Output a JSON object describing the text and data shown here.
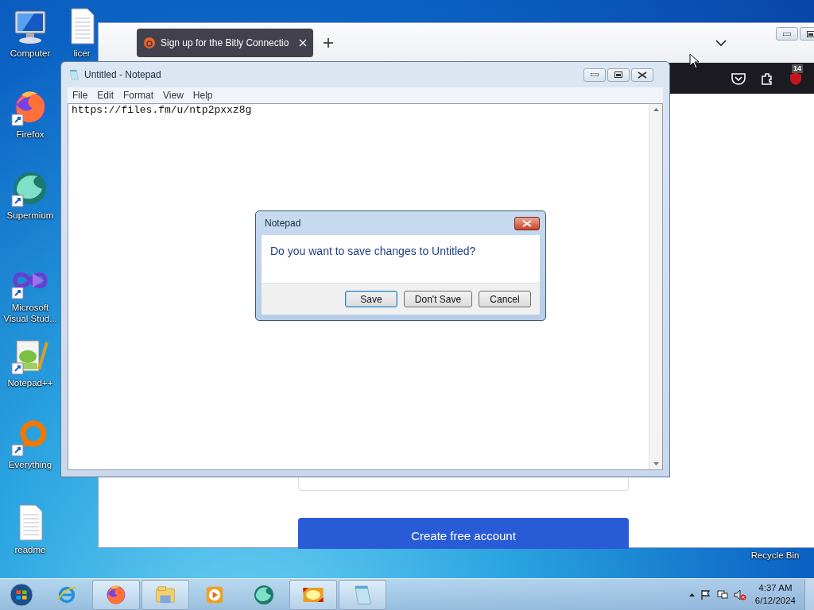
{
  "desktop_icons": [
    {
      "kind": "computer",
      "label": "Computer",
      "shortcut": false
    },
    {
      "kind": "document",
      "label": "licer",
      "shortcut": false
    },
    {
      "kind": "firefox",
      "label": "Firefox",
      "shortcut": true
    },
    {
      "kind": "supermium",
      "label": "Supermium",
      "shortcut": true
    },
    {
      "kind": "visualstudio",
      "label": "Microsoft Visual Stud...",
      "shortcut": true
    },
    {
      "kind": "notepadpp",
      "label": "Notepad++",
      "shortcut": true
    },
    {
      "kind": "everything",
      "label": "Everything",
      "shortcut": true
    },
    {
      "kind": "document",
      "label": "readme",
      "shortcut": false
    },
    {
      "label": "Recycle Bin"
    }
  ],
  "browser": {
    "tab": {
      "title": "Sign up for the Bitly Connectio"
    },
    "extension_badge": "14",
    "page": {
      "button": "Create free account"
    }
  },
  "notepad": {
    "title": "Untitled - Notepad",
    "menu": [
      "File",
      "Edit",
      "Format",
      "View",
      "Help"
    ],
    "content": "https://files.fm/u/ntp2pxxz8g"
  },
  "dialog": {
    "title": "Notepad",
    "message": "Do you want to save changes to Untitled?",
    "buttons": [
      {
        "label": "Save",
        "selected": true
      },
      {
        "label": "Don't Save",
        "selected": false
      },
      {
        "label": "Cancel",
        "selected": false
      }
    ]
  },
  "taskbar": {
    "items": [
      {
        "kind": "ie",
        "running": false
      },
      {
        "kind": "firefox",
        "running": true
      },
      {
        "kind": "explorer",
        "running": true
      },
      {
        "kind": "mediaplayer",
        "running": false
      },
      {
        "kind": "supermium",
        "running": false
      },
      {
        "kind": "picture-app",
        "running": true
      },
      {
        "kind": "notepad",
        "running": true
      }
    ],
    "clock": {
      "time": "4:37 AM",
      "date": "6/12/2024"
    }
  }
}
